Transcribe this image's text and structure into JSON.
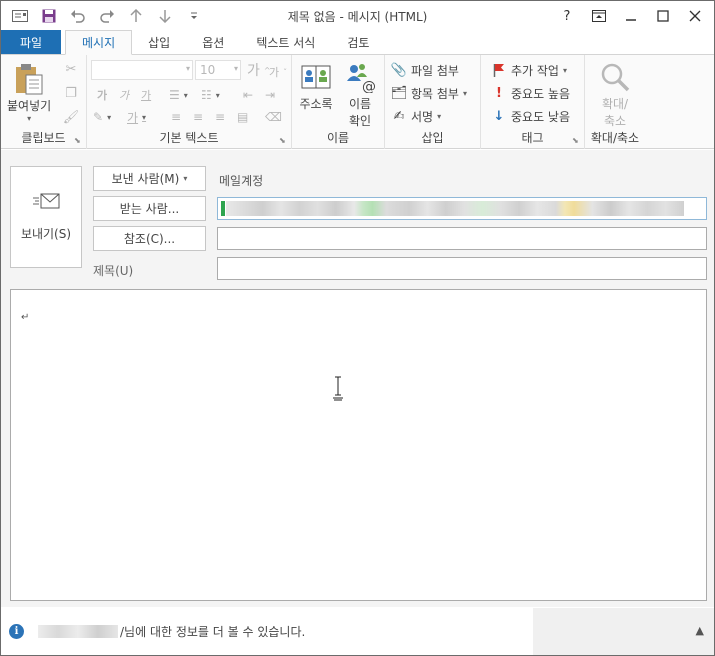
{
  "window": {
    "title": "제목 없음 - 메시지 (HTML)",
    "help": "?"
  },
  "quick_access": [
    {
      "name": "message-icon",
      "glyph": "✉"
    },
    {
      "name": "save-icon",
      "glyph": "💾"
    },
    {
      "name": "undo-icon",
      "glyph": "↶"
    },
    {
      "name": "redo-icon",
      "glyph": "↷"
    },
    {
      "name": "up-arrow-icon",
      "glyph": "↑"
    },
    {
      "name": "down-arrow-icon",
      "glyph": "↓"
    },
    {
      "name": "customize-icon",
      "glyph": "▾"
    }
  ],
  "tabs": [
    {
      "label": "파일",
      "id": "file"
    },
    {
      "label": "메시지",
      "id": "message",
      "active": true
    },
    {
      "label": "삽입",
      "id": "insert"
    },
    {
      "label": "옵션",
      "id": "options"
    },
    {
      "label": "텍스트 서식",
      "id": "format"
    },
    {
      "label": "검토",
      "id": "review"
    }
  ],
  "ribbon": {
    "clipboard": {
      "label": "클립보드",
      "paste": "붙여넣기"
    },
    "basic_text": {
      "label": "기본 텍스트",
      "font_size": "10",
      "grow": "가",
      "shrink": "가",
      "bold": "가",
      "italic": "가",
      "underline": "가",
      "highlight": "가"
    },
    "names": {
      "label": "이름",
      "address_book": "주소록",
      "check_names": "이름\n확인",
      "check_line1": "이름",
      "check_line2": "확인"
    },
    "include": {
      "label": "삽입",
      "attach_file": "파일 첨부",
      "attach_item": "항목 첨부",
      "signature": "서명"
    },
    "tags": {
      "label": "태그",
      "follow_up": "추가 작업",
      "high": "중요도 높음",
      "low": "중요도 낮음"
    },
    "zoom": {
      "label": "확대/축소",
      "btn_line1": "확대/",
      "btn_line2": "축소"
    }
  },
  "compose": {
    "send": "보내기(S)",
    "from_button": "보낸 사람(M)",
    "from_value": "메일계정",
    "to_button": "받는 사람...",
    "cc_button": "참조(C)...",
    "subject_label": "제목(U)",
    "body_paragraph_mark": "↵"
  },
  "infobar": {
    "text": "/님에 대한 정보를 더 볼 수 있습니다."
  },
  "colors": {
    "accent": "#1e6fb4",
    "file_tab": "#1e6fb4",
    "info_icon": "#2b73b7",
    "save_icon": "#7a3d8c"
  }
}
